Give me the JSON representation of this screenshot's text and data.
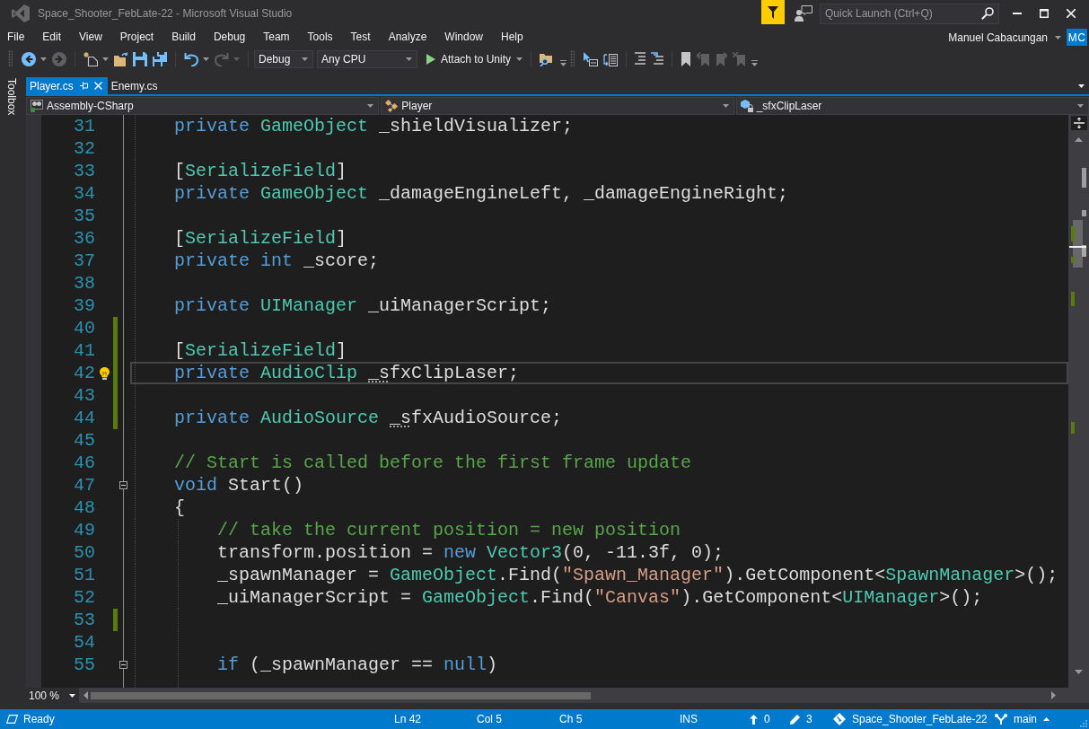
{
  "title_bar": {
    "title": "Space_Shooter_FebLate-22 - Microsoft Visual Studio",
    "quick_launch": {
      "placeholder": "Quick Launch (Ctrl+Q)"
    }
  },
  "menu": [
    "File",
    "Edit",
    "View",
    "Project",
    "Build",
    "Debug",
    "Team",
    "Tools",
    "Test",
    "Analyze",
    "Window",
    "Help"
  ],
  "account": {
    "name": "Manuel Cabacungan",
    "initials": "MC"
  },
  "toolbars": [
    {
      "groups": [
        [
          {
            "kind": "icon",
            "disabled": false,
            "menu": true
          },
          {
            "kind": "icon",
            "disabled": true
          }
        ],
        [
          {
            "kind": "icon",
            "disabled": false,
            "menu": true
          },
          {
            "kind": "icon",
            "disabled": false
          },
          {
            "kind": "icon",
            "disabled": false
          },
          {
            "kind": "icon",
            "disabled": false
          }
        ],
        [
          {
            "kind": "icon",
            "disabled": false,
            "menu": true
          },
          {
            "kind": "icon",
            "disabled": true,
            "menu": true
          }
        ],
        [
          {
            "kind": "dropdown",
            "value": "Debug"
          },
          {
            "kind": "dropdown",
            "value": "Any CPU"
          },
          {
            "kind": "run",
            "label": "Attach to Unity",
            "menu": true
          }
        ],
        [
          {
            "kind": "icon",
            "disabled": false
          }
        ]
      ]
    },
    {
      "groups": [
        [
          {
            "kind": "icon",
            "disabled": false
          },
          {
            "kind": "icon",
            "disabled": false
          }
        ],
        [
          {
            "kind": "icon",
            "disabled": false
          },
          {
            "kind": "icon",
            "disabled": false
          }
        ],
        [
          {
            "kind": "icon",
            "disabled": false
          },
          {
            "kind": "icon",
            "disabled": true
          },
          {
            "kind": "icon",
            "disabled": true
          },
          {
            "kind": "icon",
            "disabled": true
          }
        ]
      ]
    }
  ],
  "toolbox": {
    "label": "Toolbox"
  },
  "tabs": [
    {
      "label": "Player.cs",
      "selected": true
    },
    {
      "label": "Enemy.cs",
      "selected": false
    }
  ],
  "navigation_bar": [
    "Assembly-CSharp",
    "Player",
    "_sfxClipLaser"
  ],
  "editor": {
    "lines": [
      {
        "number": "31",
        "changed": false,
        "current": false,
        "tokens": [
          {
            "kind": "keyword",
            "text": "    private"
          },
          {
            "kind": "type",
            "text": " GameObject"
          },
          {
            "kind": "plain",
            "text": " _shieldVisualizer;"
          }
        ]
      },
      {
        "number": "32",
        "changed": false,
        "current": false
      },
      {
        "number": "33",
        "changed": false,
        "current": false,
        "tokens": [
          {
            "kind": "plain",
            "text": "    ["
          },
          {
            "kind": "type",
            "text": "SerializeField"
          },
          {
            "kind": "plain",
            "text": "]"
          }
        ]
      },
      {
        "number": "34",
        "changed": false,
        "current": false,
        "tokens": [
          {
            "kind": "keyword",
            "text": "    private"
          },
          {
            "kind": "type",
            "text": " GameObject"
          },
          {
            "kind": "plain",
            "text": " _damageEngineLeft, _damageEngineRight;"
          }
        ]
      },
      {
        "number": "35",
        "changed": false,
        "current": false
      },
      {
        "number": "36",
        "changed": false,
        "current": false,
        "tokens": [
          {
            "kind": "plain",
            "text": "    ["
          },
          {
            "kind": "type",
            "text": "SerializeField"
          },
          {
            "kind": "plain",
            "text": "]"
          }
        ]
      },
      {
        "number": "37",
        "changed": false,
        "current": false,
        "tokens": [
          {
            "kind": "keyword",
            "text": "    private"
          },
          {
            "kind": "keyword",
            "text": " int"
          },
          {
            "kind": "plain",
            "text": " _score;"
          }
        ]
      },
      {
        "number": "38",
        "changed": false,
        "current": false
      },
      {
        "number": "39",
        "changed": false,
        "current": false,
        "tokens": [
          {
            "kind": "keyword",
            "text": "    private"
          },
          {
            "kind": "type",
            "text": " UIManager"
          },
          {
            "kind": "plain",
            "text": " _uiManagerScript;"
          }
        ]
      },
      {
        "number": "40",
        "changed": true,
        "current": false
      },
      {
        "number": "41",
        "changed": true,
        "current": false,
        "tokens": [
          {
            "kind": "plain",
            "text": "    ["
          },
          {
            "kind": "type",
            "text": "SerializeField"
          },
          {
            "kind": "plain",
            "text": "]"
          }
        ]
      },
      {
        "number": "42",
        "changed": true,
        "current": true,
        "lightbulb": true,
        "tokens": [
          {
            "kind": "keyword",
            "text": "    private"
          },
          {
            "kind": "type",
            "text": " AudioClip "
          },
          {
            "kind": "plain",
            "text": "_s",
            "dotted": true
          },
          {
            "kind": "plain",
            "text": "fxClipLaser;"
          }
        ]
      },
      {
        "number": "43",
        "changed": true,
        "current": false
      },
      {
        "number": "44",
        "changed": true,
        "current": false,
        "tokens": [
          {
            "kind": "keyword",
            "text": "    private"
          },
          {
            "kind": "type",
            "text": " AudioSource "
          },
          {
            "kind": "plain",
            "text": "_s",
            "dotted": true
          },
          {
            "kind": "plain",
            "text": "fxAudioSource;"
          }
        ]
      },
      {
        "number": "45",
        "changed": false,
        "current": false
      },
      {
        "number": "46",
        "changed": false,
        "current": false,
        "tokens": [
          {
            "kind": "comment",
            "text": "    // Start is called before the first frame update"
          }
        ]
      },
      {
        "number": "47",
        "changed": false,
        "current": false,
        "expanded": true,
        "tokens": [
          {
            "kind": "keyword",
            "text": "    void"
          },
          {
            "kind": "plain",
            "text": " Start()"
          }
        ]
      },
      {
        "number": "48",
        "changed": false,
        "current": false,
        "tokens": [
          {
            "kind": "plain",
            "text": "    {"
          }
        ]
      },
      {
        "number": "49",
        "changed": false,
        "current": false,
        "tokens": [
          {
            "kind": "comment",
            "text": "        // take the current position = new position"
          }
        ]
      },
      {
        "number": "50",
        "changed": false,
        "current": false,
        "tokens": [
          {
            "kind": "plain",
            "text": "        transform.position = "
          },
          {
            "kind": "keyword",
            "text": "new"
          },
          {
            "kind": "type",
            "text": " Vector3"
          },
          {
            "kind": "plain",
            "text": "(0, -11.3f, 0);"
          }
        ]
      },
      {
        "number": "51",
        "changed": false,
        "current": false,
        "tokens": [
          {
            "kind": "plain",
            "text": "        _spawnManager = "
          },
          {
            "kind": "type",
            "text": "GameObject"
          },
          {
            "kind": "plain",
            "text": ".Find("
          },
          {
            "kind": "string",
            "text": "\"Spawn_Manager\""
          },
          {
            "kind": "plain",
            "text": ").GetComponent<"
          },
          {
            "kind": "type",
            "text": "SpawnManager"
          },
          {
            "kind": "plain",
            "text": ">();"
          }
        ]
      },
      {
        "number": "52",
        "changed": false,
        "current": false,
        "tokens": [
          {
            "kind": "plain",
            "text": "        _uiManagerScript = "
          },
          {
            "kind": "type",
            "text": "GameObject"
          },
          {
            "kind": "plain",
            "text": ".Find("
          },
          {
            "kind": "string",
            "text": "\"Canvas\""
          },
          {
            "kind": "plain",
            "text": ").GetComponent<"
          },
          {
            "kind": "type",
            "text": "UIManager"
          },
          {
            "kind": "plain",
            "text": ">();"
          }
        ]
      },
      {
        "number": "53",
        "changed": true,
        "current": false
      },
      {
        "number": "54",
        "changed": false,
        "current": false
      },
      {
        "number": "55",
        "changed": false,
        "current": false,
        "expanded": true,
        "tokens": [
          {
            "kind": "keyword",
            "text": "        if"
          },
          {
            "kind": "plain",
            "text": " (_spawnManager == "
          },
          {
            "kind": "keyword",
            "text": "null"
          },
          {
            "kind": "plain",
            "text": ")"
          }
        ]
      }
    ]
  },
  "zoom": "100 %",
  "status_bar": {
    "state": "Ready",
    "line": "Ln 42",
    "column": "Col 5",
    "char": "Ch 5",
    "mode": "INS",
    "unpushed": "0",
    "changes": "3",
    "repository": "Space_Shooter_FebLate-22",
    "branch": "main"
  }
}
